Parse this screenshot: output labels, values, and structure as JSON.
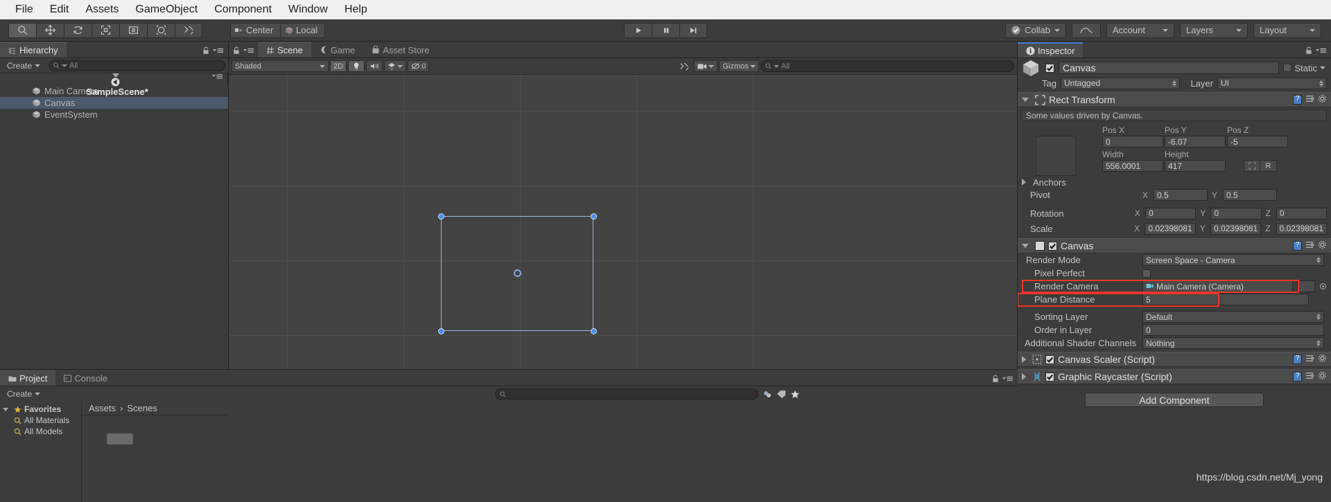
{
  "menubar": {
    "items": [
      "File",
      "Edit",
      "Assets",
      "GameObject",
      "Component",
      "Window",
      "Help"
    ]
  },
  "toolbar": {
    "tools": [
      {
        "name": "hand-tool",
        "icon": "magnifier-icon",
        "active": true
      },
      {
        "name": "move-tool",
        "icon": "move-icon",
        "active": false
      },
      {
        "name": "rotate-tool",
        "icon": "rotate-icon",
        "active": false
      },
      {
        "name": "scale-tool",
        "icon": "scale-icon",
        "active": false
      },
      {
        "name": "rect-tool",
        "icon": "rect-icon",
        "active": false
      },
      {
        "name": "transform-tool",
        "icon": "transform-icon",
        "active": false
      },
      {
        "name": "custom-tool",
        "icon": "wrench-icon",
        "active": false
      }
    ],
    "pivot_label": "Center",
    "space_label": "Local",
    "play_label": "play-icon",
    "pause_label": "pause-icon",
    "step_label": "step-icon",
    "collab_label": "Collab",
    "cloud_label": "cloud-icon",
    "account_label": "Account",
    "layers_label": "Layers",
    "layout_label": "Layout",
    "accent_blue": "#3b7fd4",
    "highlight_red": "#f0342a"
  },
  "hierarchy": {
    "tab_label": "Hierarchy",
    "create_label": "Create",
    "search_placeholder": "All",
    "scene_name": "SampleScene*",
    "objects": [
      {
        "label": "Main Camera",
        "selected": false
      },
      {
        "label": "Canvas",
        "selected": true
      },
      {
        "label": "EventSystem",
        "selected": false
      }
    ]
  },
  "scene": {
    "tabs": [
      {
        "label": "Scene",
        "icon": "grid-icon",
        "active": true
      },
      {
        "label": "Game",
        "icon": "gamepad-icon",
        "active": false
      },
      {
        "label": "Asset Store",
        "icon": "store-icon",
        "active": false
      }
    ],
    "shading_mode": "Shaded",
    "two_d_label": "2D",
    "light_icon": "light-bulb-icon",
    "audio_icon": "speaker-icon",
    "fx_icon": "effects-icon",
    "hidden_count": "0",
    "tools_icon": "scene-tools-icon",
    "camera_icon": "camera-icon",
    "gizmos_label": "Gizmos",
    "search_placeholder": "All"
  },
  "project": {
    "tabs": [
      {
        "label": "Project",
        "icon": "folder-icon",
        "active": true
      },
      {
        "label": "Console",
        "icon": "console-icon",
        "active": false
      }
    ],
    "create_label": "Create",
    "search_placeholder": "",
    "favorites_label": "Favorites",
    "favorites": [
      "All Materials",
      "All Models"
    ],
    "breadcrumbs": [
      "Assets",
      "Scenes"
    ]
  },
  "inspector": {
    "tab_label": "Inspector",
    "object_name": "Canvas",
    "object_enabled": true,
    "static_label": "Static",
    "tag_label": "Tag",
    "tag_value": "Untagged",
    "layer_label": "Layer",
    "layer_value": "UI",
    "rect_transform": {
      "title": "Rect Transform",
      "info": "Some values driven by Canvas.",
      "pos_headers": [
        "Pos X",
        "Pos Y",
        "Pos Z"
      ],
      "pos_values": [
        "0",
        "-6.07",
        "-5"
      ],
      "size_headers": [
        "Width",
        "Height"
      ],
      "size_values": [
        "556.0001",
        "417"
      ],
      "blueprint_btn": "blueprint-icon",
      "raw_btn": "R",
      "anchors_label": "Anchors",
      "pivot_label": "Pivot",
      "pivot_values": [
        "0.5",
        "0.5"
      ],
      "rotation_label": "Rotation",
      "rotation_values": [
        "0",
        "0",
        "0"
      ],
      "scale_label": "Scale",
      "scale_values": [
        "0.02398081",
        "0.02398081",
        "0.02398081"
      ],
      "axis_labels": [
        "X",
        "Y",
        "Z"
      ]
    },
    "canvas": {
      "title": "Canvas",
      "enabled": true,
      "rows": [
        {
          "label": "Render Mode",
          "value": "Screen Space - Camera",
          "type": "popup",
          "highlight": false
        },
        {
          "label": "Pixel Perfect",
          "value": "",
          "type": "checkbox",
          "highlight": false
        },
        {
          "label": "Render Camera",
          "value": "Main Camera (Camera)",
          "type": "object",
          "highlight": true
        },
        {
          "label": "Plane Distance",
          "value": "5",
          "type": "text",
          "highlight": true
        },
        {
          "label": "Sorting Layer",
          "value": "Default",
          "type": "popup",
          "highlight": false
        },
        {
          "label": "Order in Layer",
          "value": "0",
          "type": "text",
          "highlight": false
        },
        {
          "label": "Additional Shader Channels",
          "value": "Nothing",
          "type": "popup",
          "highlight": false
        }
      ]
    },
    "components": [
      {
        "title": "Canvas Scaler (Script)",
        "enabled": true,
        "icon": "canvas-scaler-icon"
      },
      {
        "title": "Graphic Raycaster (Script)",
        "enabled": true,
        "icon": "raycaster-icon"
      }
    ],
    "add_component_label": "Add Component"
  },
  "watermark": "https://blog.csdn.net/Mj_yong"
}
